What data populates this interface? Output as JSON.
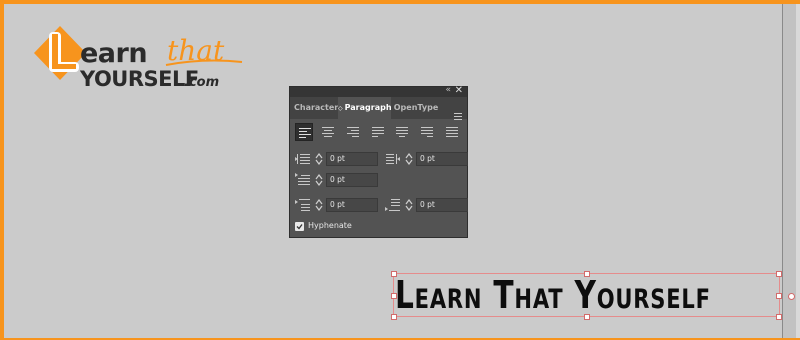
{
  "logo": {
    "word_earn": "earn",
    "word_that": "that",
    "word_yourself": "YOURSELF",
    "word_com": ".com",
    "brand_orange": "#f7941d",
    "brand_dark": "#2b2b2b"
  },
  "panel": {
    "tabs": [
      {
        "label": "Character",
        "active": false
      },
      {
        "label": "Paragraph",
        "active": true
      },
      {
        "label": "OpenType",
        "active": false
      }
    ],
    "alignment_buttons": [
      {
        "name": "align-left",
        "active": true
      },
      {
        "name": "align-center",
        "active": false
      },
      {
        "name": "align-right",
        "active": false
      },
      {
        "name": "justify-last-left",
        "active": false
      },
      {
        "name": "justify-last-center",
        "active": false
      },
      {
        "name": "justify-last-right",
        "active": false
      },
      {
        "name": "justify-all",
        "active": false
      }
    ],
    "left_indent": "0 pt",
    "right_indent": "0 pt",
    "first_line_indent": "0 pt",
    "space_before": "0 pt",
    "space_after": "0 pt",
    "hyphenate_label": "Hyphenate",
    "hyphenate_checked": true
  },
  "canvas": {
    "text": "Learn That Yourself"
  },
  "colors": {
    "frame_border": "#f7941d",
    "artboard": "#cbcbcb",
    "panel_bg": "#535353",
    "selection": "#d26b6b"
  }
}
